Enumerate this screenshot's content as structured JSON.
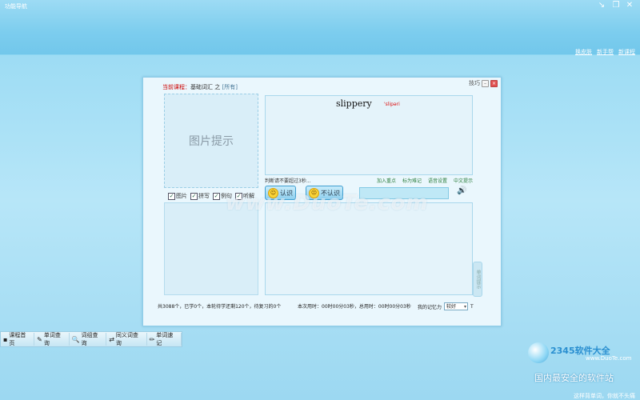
{
  "window": {
    "title": "功能导航",
    "controls": {
      "restore_icon": "↘",
      "max_icon": "❐",
      "close_icon": "✕"
    }
  },
  "top_links": [
    "换皮肤",
    "新手帮",
    "新课程"
  ],
  "card": {
    "course_label": "当前课程：",
    "course_name": "基础词汇 之",
    "course_filter": "[所有]",
    "tools_label": "技巧",
    "min_icon": "–",
    "close_icon": "×",
    "image_hint": "图片提示",
    "checkboxes": [
      {
        "label": "图片",
        "checked": true
      },
      {
        "label": "拼写",
        "checked": true
      },
      {
        "label": "例句",
        "checked": true
      },
      {
        "label": "听解",
        "checked": true
      }
    ],
    "word": "slippery",
    "phonetic": "'slipəri",
    "judge_text": "判断请不要超过3秒...",
    "actions": [
      "加入重点",
      "标为难记",
      "语音设置",
      "中文提示"
    ],
    "know_button": "认识",
    "not_know_button": "不认识",
    "side_tab": "单词提示",
    "stats": "共3088个，已学0个，本轮待学还剩120个，待复习的0个",
    "timing": "本次用时：00时00分03秒，总用时：00时00分03秒",
    "memory_label": "我的记忆力",
    "memory_value": "较好",
    "memory_suffix": "T"
  },
  "taskbar": [
    {
      "label": "课程首页",
      "icon": "home-icon",
      "glyph": "▪"
    },
    {
      "label": "单词查询",
      "icon": "word-search-icon",
      "glyph": "✎"
    },
    {
      "label": "词组查询",
      "icon": "magnifier-icon",
      "glyph": "🔍"
    },
    {
      "label": "同义词查询",
      "icon": "synonym-icon",
      "glyph": "⇄"
    },
    {
      "label": "单词速记",
      "icon": "pencil-icon",
      "glyph": "✏"
    }
  ],
  "watermark": "www.DuoTe.com",
  "brand": {
    "name": "2345软件大全",
    "url": "www.DuoTe.com",
    "slogan": "国内最安全的软件站"
  },
  "bottom_note": "这样背单词，你就不头痛"
}
